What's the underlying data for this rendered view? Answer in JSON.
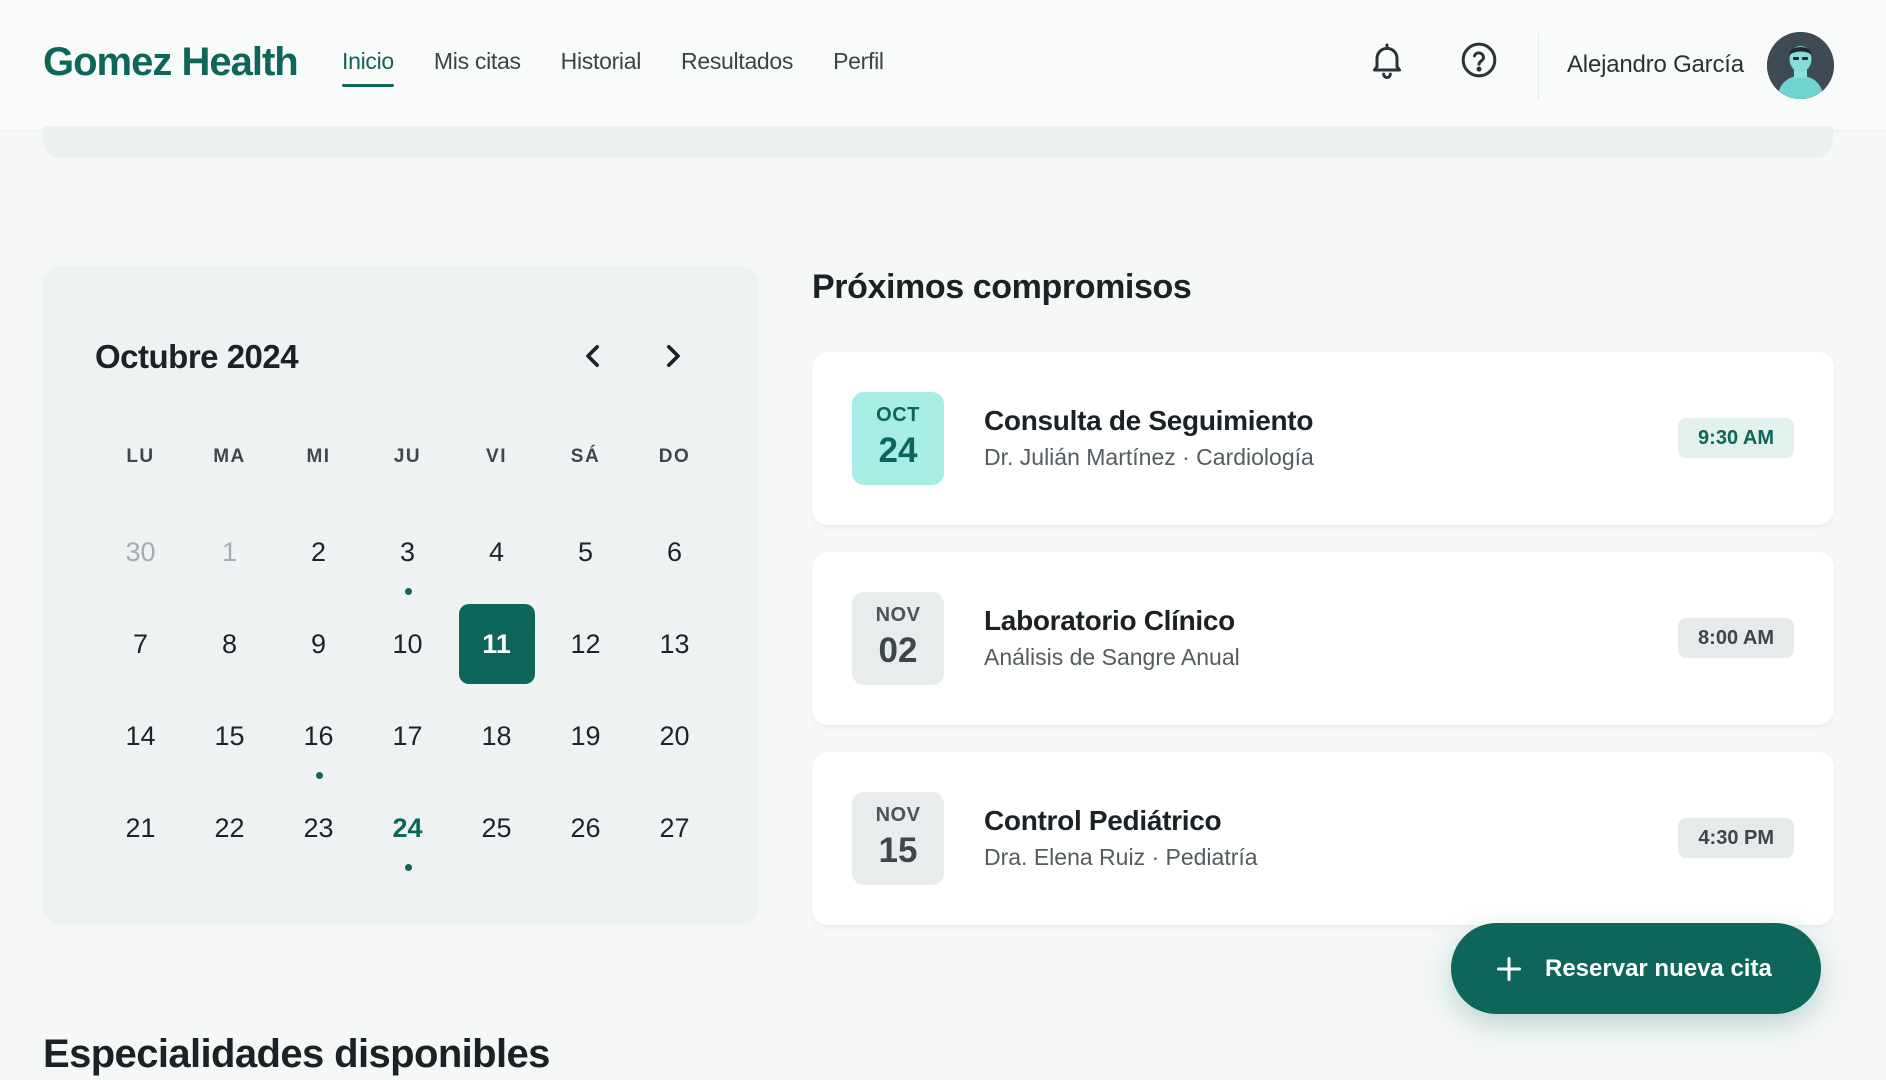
{
  "brand": "Gomez Health",
  "nav": [
    {
      "label": "Inicio",
      "active": true
    },
    {
      "label": "Mis citas",
      "active": false
    },
    {
      "label": "Historial",
      "active": false
    },
    {
      "label": "Resultados",
      "active": false
    },
    {
      "label": "Perfil",
      "active": false
    }
  ],
  "header": {
    "bell_icon": "bell-icon",
    "help_icon": "help-circle-icon",
    "user_name": "Alejandro García"
  },
  "calendar": {
    "title": "Octubre 2024",
    "weekdays": [
      "LU",
      "MA",
      "MI",
      "JU",
      "VI",
      "SÁ",
      "DO"
    ],
    "days": [
      {
        "n": "30",
        "muted": true
      },
      {
        "n": "1",
        "muted": true
      },
      {
        "n": "2"
      },
      {
        "n": "3",
        "dot": true
      },
      {
        "n": "4"
      },
      {
        "n": "5"
      },
      {
        "n": "6"
      },
      {
        "n": "7"
      },
      {
        "n": "8"
      },
      {
        "n": "9"
      },
      {
        "n": "10"
      },
      {
        "n": "11",
        "selected": true
      },
      {
        "n": "12"
      },
      {
        "n": "13"
      },
      {
        "n": "14"
      },
      {
        "n": "15"
      },
      {
        "n": "16",
        "dot": true
      },
      {
        "n": "17"
      },
      {
        "n": "18"
      },
      {
        "n": "19"
      },
      {
        "n": "20"
      },
      {
        "n": "21"
      },
      {
        "n": "22"
      },
      {
        "n": "23"
      },
      {
        "n": "24",
        "accent": true,
        "dot": true
      },
      {
        "n": "25"
      },
      {
        "n": "26"
      },
      {
        "n": "27"
      }
    ]
  },
  "upcoming": {
    "title": "Próximos compromisos",
    "items": [
      {
        "month": "OCT",
        "day": "24",
        "title": "Consulta de Seguimiento",
        "subtitle": "Dr. Julián Martínez · Cardiología",
        "time": "9:30 AM",
        "highlight": true
      },
      {
        "month": "NOV",
        "day": "02",
        "title": "Laboratorio Clínico",
        "subtitle": "Análisis de Sangre Anual",
        "time": "8:00 AM",
        "highlight": false
      },
      {
        "month": "NOV",
        "day": "15",
        "title": "Control Pediátrico",
        "subtitle": "Dra. Elena Ruiz · Pediatría",
        "time": "4:30 PM",
        "highlight": false
      }
    ]
  },
  "fab_label": "Reservar nueva cita",
  "specialties_title": "Especialidades disponibles",
  "colors": {
    "primary": "#0d6659",
    "highlight_date_bg": "#a8ece6",
    "background": "#f6f8f8"
  }
}
